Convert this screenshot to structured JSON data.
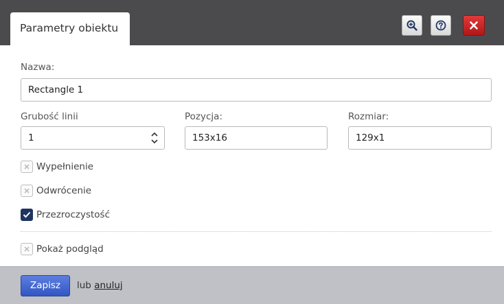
{
  "dialog": {
    "title": "Parametry obiektu",
    "buttons": [
      {
        "icon": "zoom-in-icon"
      },
      {
        "icon": "help-icon"
      },
      {
        "icon": "close-icon"
      }
    ]
  },
  "form": {
    "name_label": "Nazwa:",
    "name_value": "Rectangle 1",
    "line_width_label": "Grubość linii",
    "line_width_value": "1",
    "position_label": "Pozycja:",
    "position_value": "153x16",
    "size_label": "Rozmiar:",
    "size_value": "129x1",
    "checkboxes": [
      {
        "label": "Wypełnienie",
        "checked": false
      },
      {
        "label": "Odwrócenie",
        "checked": false
      },
      {
        "label": "Przezroczystość",
        "checked": true
      }
    ],
    "preview": {
      "label": "Pokaż podgląd",
      "checked": false
    }
  },
  "footer": {
    "save_label": "Zapisz",
    "or_text": "lub",
    "cancel_label": "anuluj"
  },
  "colors": {
    "titlebar": "#4b4b4e",
    "close_button": "#c62020",
    "save_button": "#3f63d0",
    "checkbox_checked": "#1f3560",
    "footer": "#bfc1c6"
  }
}
